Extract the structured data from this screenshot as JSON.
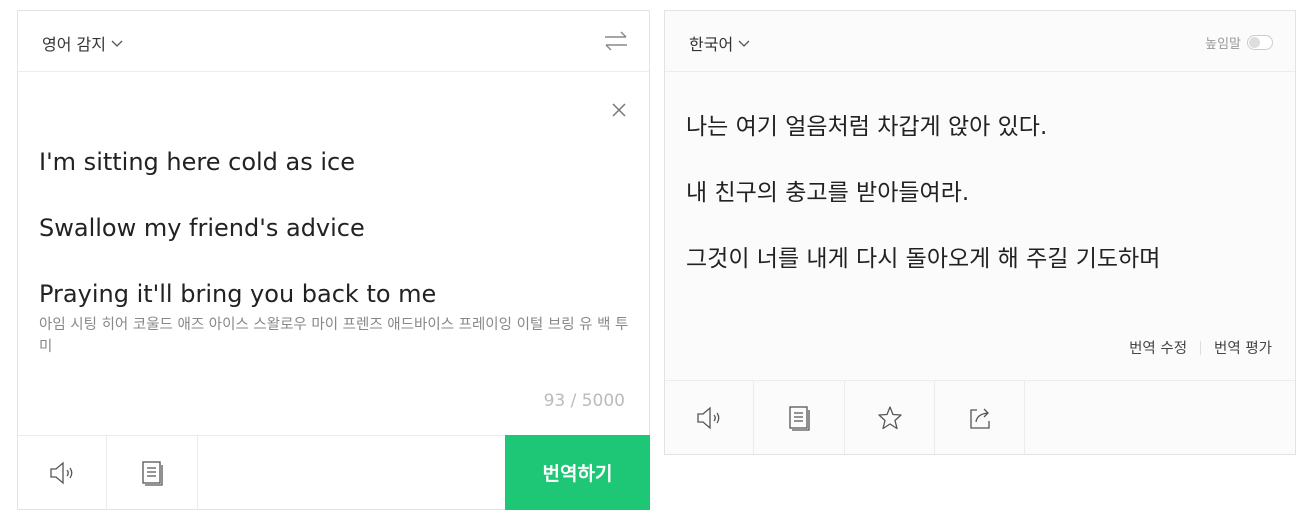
{
  "source": {
    "language_label": "영어 감지",
    "lines": [
      "I'm sitting here cold as ice",
      "Swallow my friend's advice",
      "Praying it'll bring you back to me"
    ],
    "pronunciation": "아임 시팅 히어 코울드 애즈 아이스 스왈로우 마이 프렌즈 애드바이스 프레이잉 이털 브링 유 백 투 미",
    "char_count": "93 / 5000",
    "translate_label": "번역하기"
  },
  "target": {
    "language_label": "한국어",
    "honorific_label": "높임말",
    "honorific_enabled": false,
    "lines": [
      "나는 여기 얼음처럼 차갑게 앉아 있다.",
      "내 친구의 충고를 받아들여라.",
      "그것이 너를 내게 다시 돌아오게 해 주길 기도하며"
    ],
    "edit_label": "번역 수정",
    "rate_label": "번역 평가"
  },
  "colors": {
    "accent": "#1ec776",
    "border": "#e3e3e3",
    "muted_text": "#888888"
  },
  "icons": {
    "source_toolbar": [
      "speaker-icon",
      "document-icon"
    ],
    "target_toolbar": [
      "speaker-icon",
      "document-icon",
      "star-icon",
      "share-icon"
    ],
    "swap": "swap-arrows-icon",
    "clear": "close-icon"
  }
}
